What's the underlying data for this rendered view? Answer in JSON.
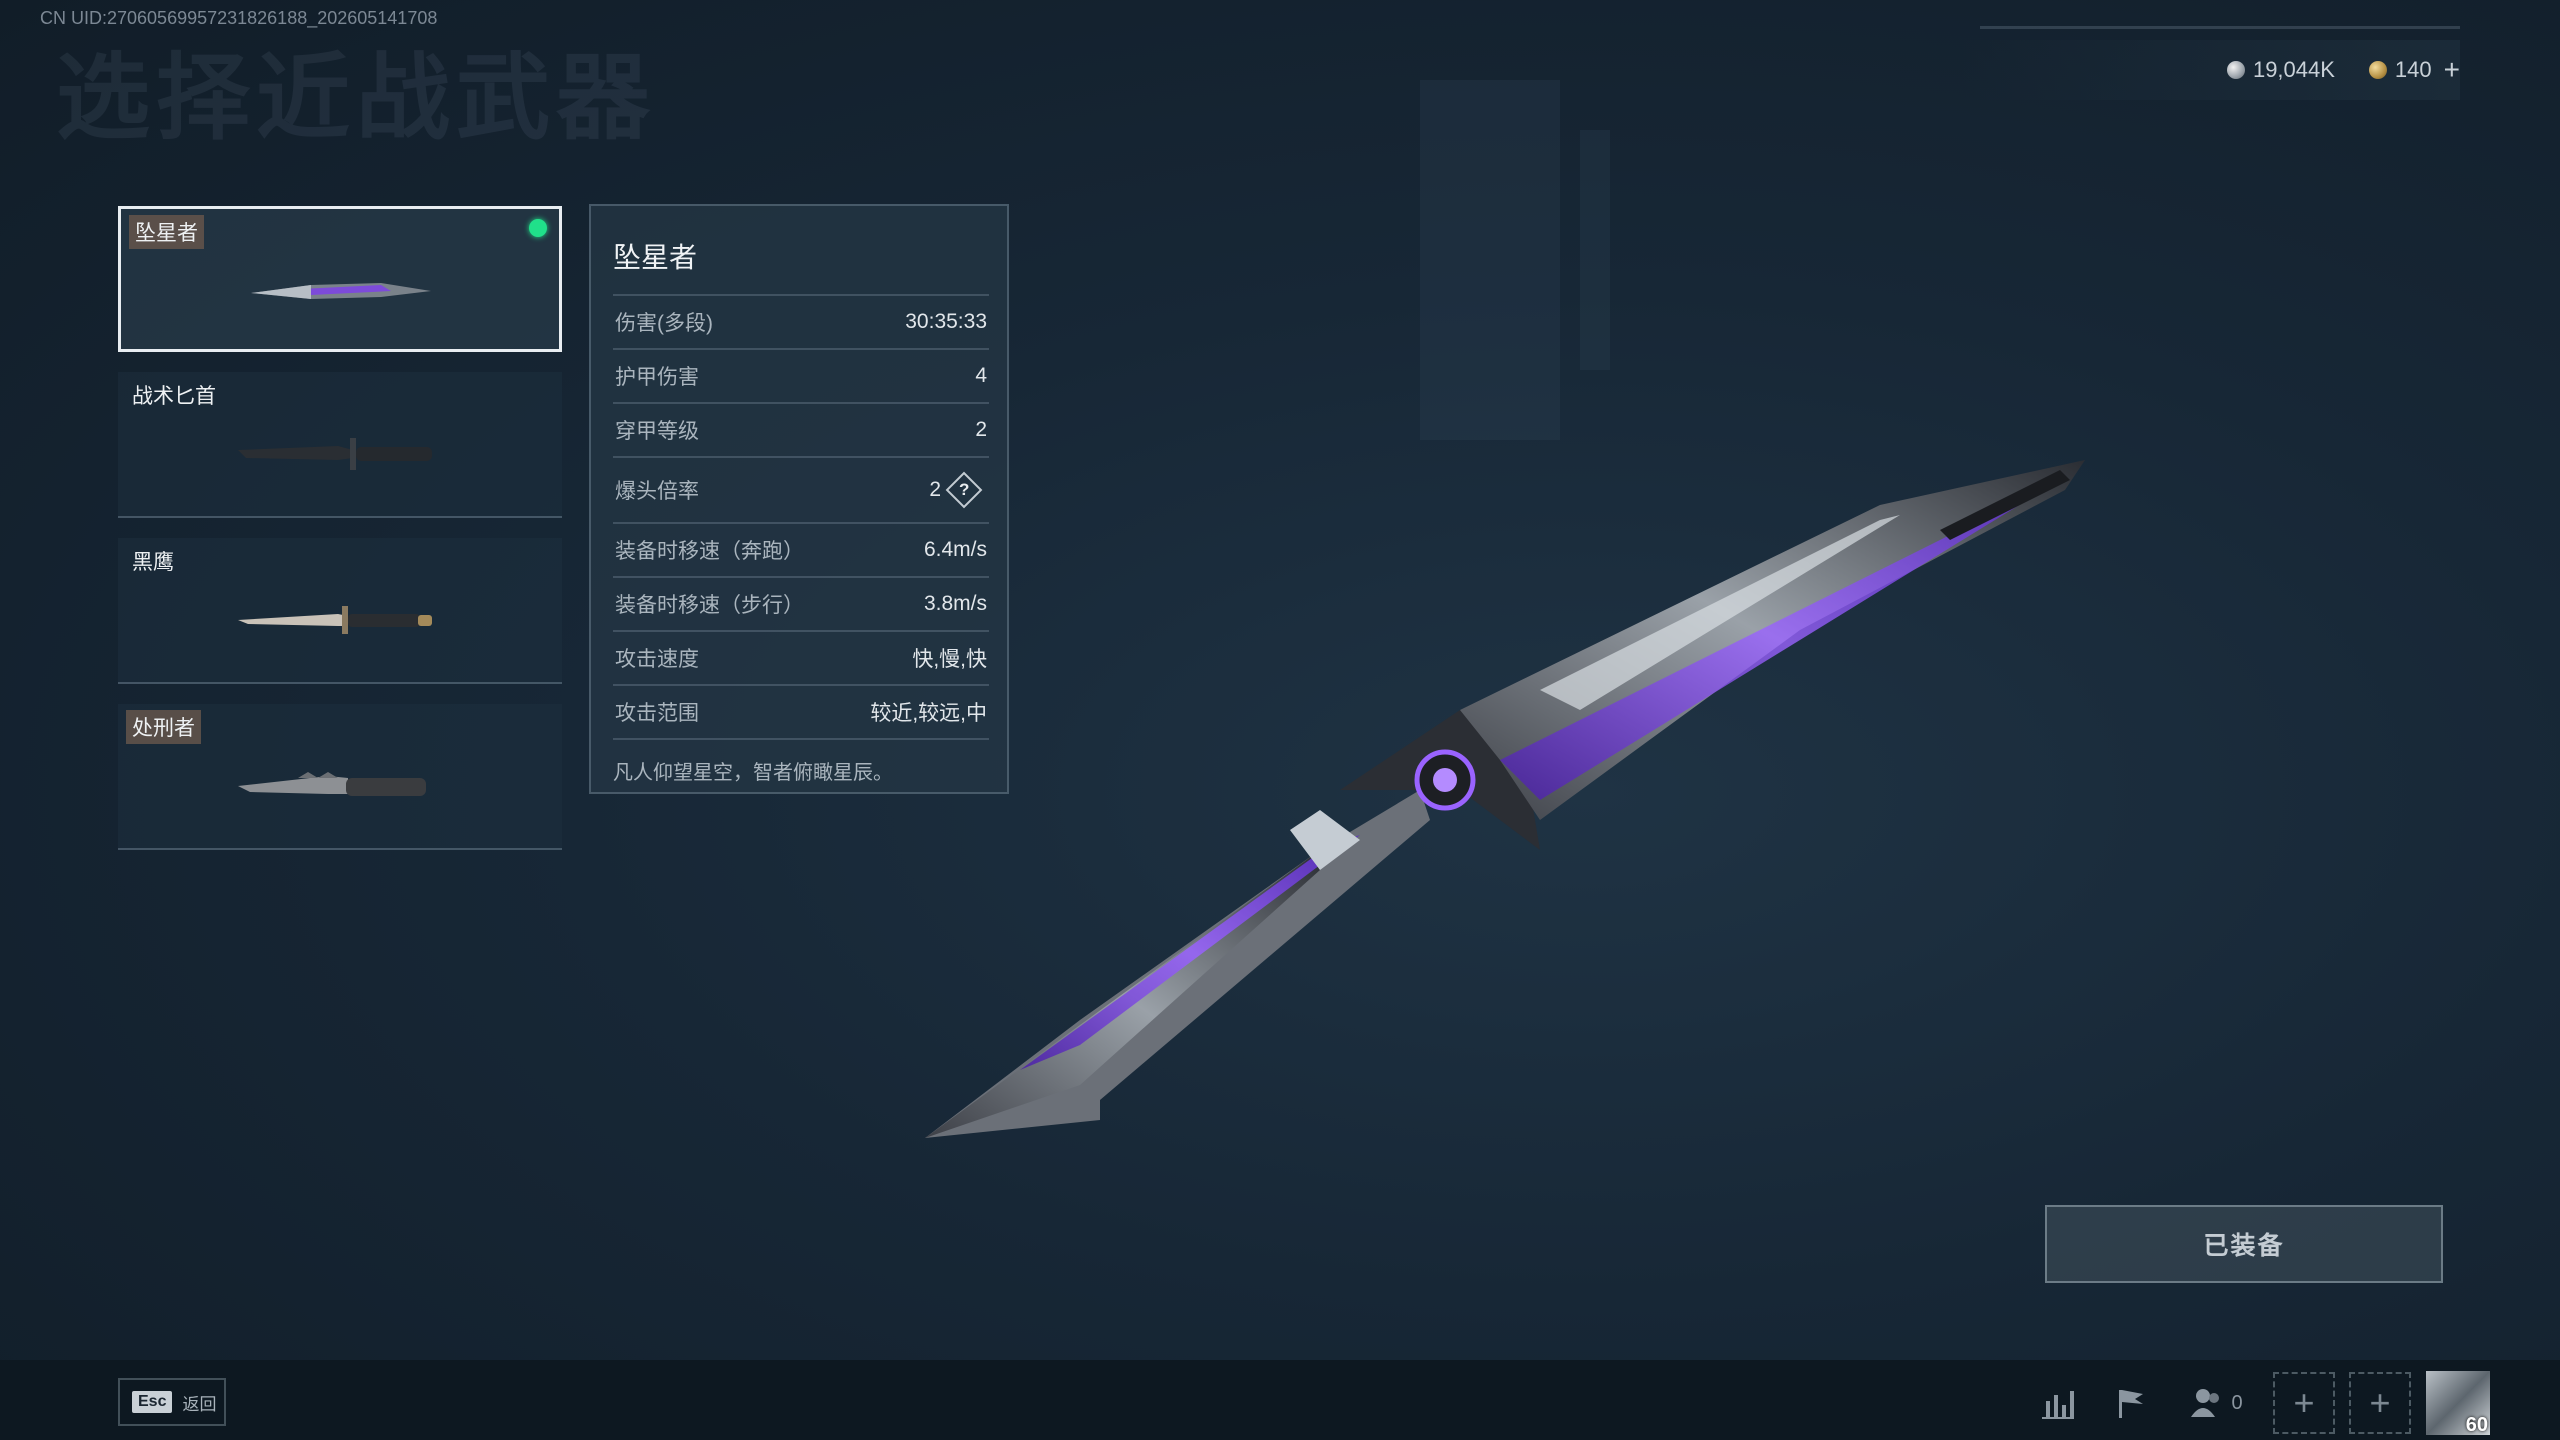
{
  "uid_text": "CN UID:27060569957231826188_202605141708",
  "page_title": "选择近战武器",
  "currency": {
    "silver_amount": "19,044K",
    "gold_amount": "140",
    "add_symbol": "+",
    "silver_icon": "silver-coin-icon",
    "gold_icon": "gold-coin-icon"
  },
  "weapons": [
    {
      "label": "坠星者",
      "tagged": true,
      "selected": true,
      "equipped": true
    },
    {
      "label": "战术匕首",
      "tagged": false,
      "selected": false,
      "equipped": false
    },
    {
      "label": "黑鹰",
      "tagged": false,
      "selected": false,
      "equipped": false
    },
    {
      "label": "处刑者",
      "tagged": true,
      "selected": false,
      "equipped": false
    }
  ],
  "detail": {
    "title": "坠星者",
    "stats": [
      {
        "name": "伤害(多段)",
        "value": "30:35:33"
      },
      {
        "name": "护甲伤害",
        "value": "4"
      },
      {
        "name": "穿甲等级",
        "value": "2"
      },
      {
        "name": "爆头倍率",
        "value": "2",
        "help": "?"
      },
      {
        "name": "装备时移速（奔跑）",
        "value": "6.4m/s"
      },
      {
        "name": "装备时移速（步行）",
        "value": "3.8m/s"
      },
      {
        "name": "攻击速度",
        "value": "快,慢,快"
      },
      {
        "name": "攻击范围",
        "value": "较近,较远,中"
      }
    ],
    "flavor": "凡人仰望星空，智者俯瞰星辰。"
  },
  "equip_button": "已装备",
  "footer": {
    "esc_key": "Esc",
    "back_label": "返回",
    "friends_count": "0",
    "slot_symbol": "+",
    "level": "60"
  },
  "colors": {
    "equipped_dot": "#20e08a",
    "accent_purple": "#8a4dff"
  }
}
